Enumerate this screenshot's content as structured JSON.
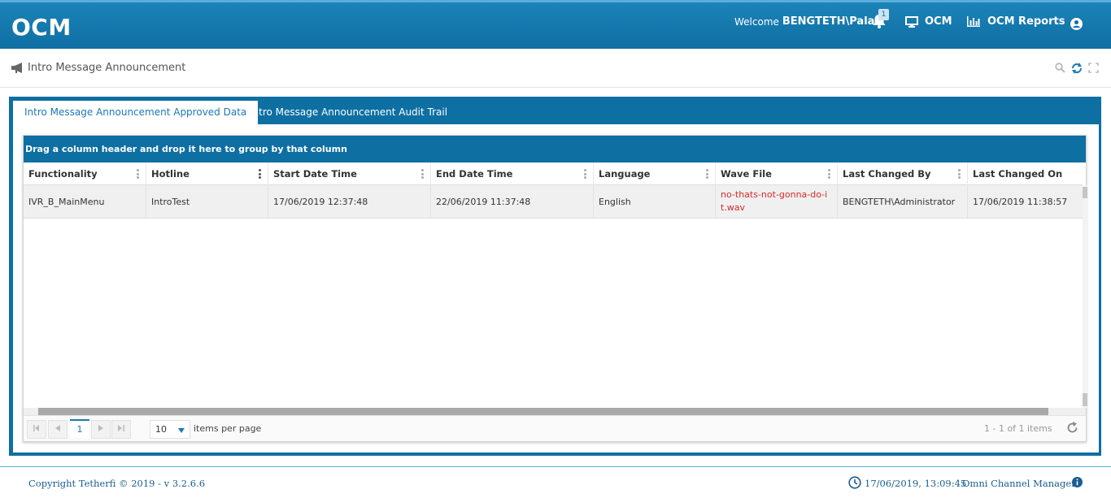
{
  "header": {
    "logo": "OCM",
    "welcome_prefix": "Welcome",
    "username": "BENGTETH\\Palak",
    "notification_count": "1",
    "nav_ocm": "OCM",
    "nav_reports": "OCM Reports",
    "icons": [
      "bell-icon",
      "monitor-icon",
      "bar-chart-icon",
      "user-circle-icon"
    ]
  },
  "page": {
    "title": "Intro Message Announcement",
    "tools": [
      "search-icon",
      "refresh-icon",
      "fullscreen-icon"
    ]
  },
  "tabs": [
    {
      "label": "Intro Message Announcement Approved Data",
      "active": true
    },
    {
      "label": "Intro Message Announcement Audit Trail",
      "active": false
    }
  ],
  "grid": {
    "group_hint": "Drag a column header and drop it here to group by that column",
    "columns": [
      "Functionality",
      "Hotline",
      "Start Date Time",
      "End Date Time",
      "Language",
      "Wave File",
      "Last Changed By",
      "Last Changed On"
    ],
    "rows": [
      {
        "functionality": "IVR_B_MainMenu",
        "hotline": "IntroTest",
        "start": "17/06/2019 12:37:48",
        "end": "22/06/2019 11:37:48",
        "language": "English",
        "wave_file": "no-thats-not-gonna-do-it.wav",
        "changed_by": "BENGTETH\\Administrator",
        "changed_on": "17/06/2019 11:38:57"
      }
    ],
    "pager": {
      "current_page": "1",
      "page_size": "10",
      "items_label": "items per page",
      "info": "1 - 1 of 1 items"
    }
  },
  "footer": {
    "copyright": "Copyright Tetherfi © 2019 - v 3.2.6.6",
    "datetime": "17/06/2019, 13:09:45",
    "app_name": "Omni Channel Manager"
  },
  "colors": {
    "brand": "#0e6fa3",
    "link": "#1a79b6",
    "wave_file_text": "#d42b2b"
  }
}
